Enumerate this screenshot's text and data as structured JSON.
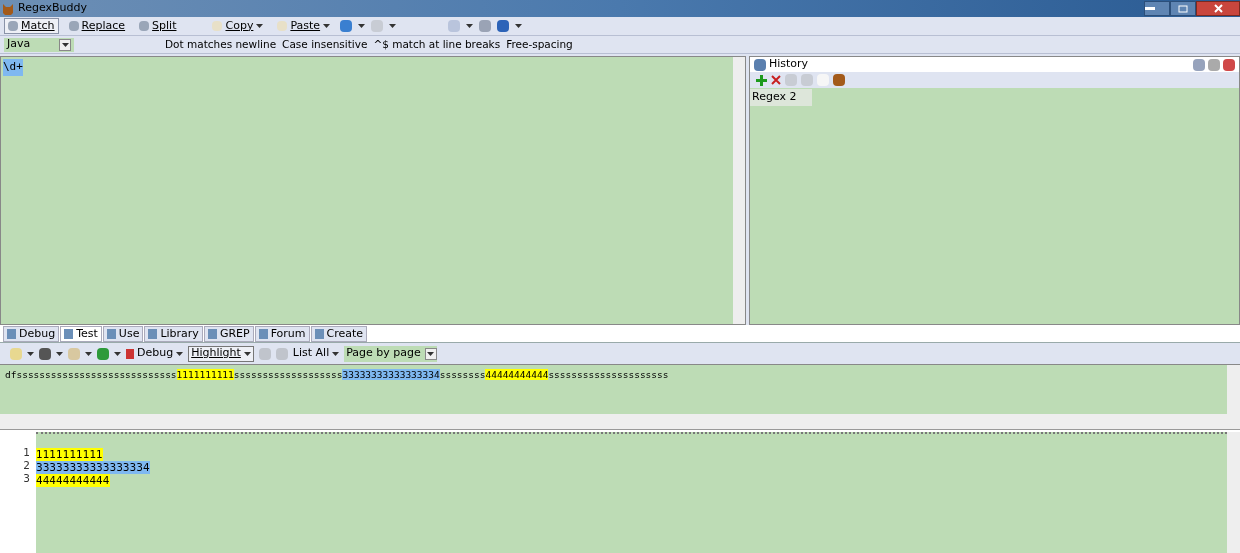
{
  "window": {
    "title": "RegexBuddy"
  },
  "toolbar": [
    {
      "label": "Match",
      "selected": true,
      "kind": "mode"
    },
    {
      "label": "Replace",
      "selected": false,
      "kind": "mode"
    },
    {
      "label": "Split",
      "selected": false,
      "kind": "mode"
    },
    {
      "label": "Copy",
      "selected": false,
      "kind": "menu"
    },
    {
      "label": "Paste",
      "selected": false,
      "kind": "menu"
    }
  ],
  "flavor": "Java",
  "options": [
    "Dot matches newline",
    "Case insensitive",
    "^$ match at line breaks",
    "Free-spacing"
  ],
  "regex": "\\d+",
  "history": {
    "title": "History",
    "items": [
      "Regex 2"
    ]
  },
  "tabs": [
    {
      "label": "Debug",
      "selected": false
    },
    {
      "label": "Test",
      "selected": true
    },
    {
      "label": "Use",
      "selected": false
    },
    {
      "label": "Library",
      "selected": false
    },
    {
      "label": "GREP",
      "selected": false
    },
    {
      "label": "Forum",
      "selected": false
    },
    {
      "label": "Create",
      "selected": false
    }
  ],
  "test_toolbar": {
    "debug": "Debug",
    "highlight": {
      "label": "Highlight",
      "selected": true
    },
    "list_all": "List All",
    "scope": "Page by page"
  },
  "test_text": [
    {
      "text": "dfssssssssssssssssssssssssssss"
    },
    {
      "text": "1111111111",
      "color": "#ffff00"
    },
    {
      "text": "sssssssssssssssssss"
    },
    {
      "text": "33333333333333334",
      "color": "#7fb8f0"
    },
    {
      "text": "ssssssss"
    },
    {
      "text": "44444444444",
      "color": "#ffff00"
    },
    {
      "text": "sssssssssssssssssssss"
    }
  ],
  "results": [
    {
      "number": "1",
      "text": "1111111111",
      "color": "#ffff00"
    },
    {
      "number": "2",
      "text": "33333333333333334",
      "color": "#7fb8f0"
    },
    {
      "number": "3",
      "text": "44444444444",
      "color": "#ffff00"
    }
  ]
}
